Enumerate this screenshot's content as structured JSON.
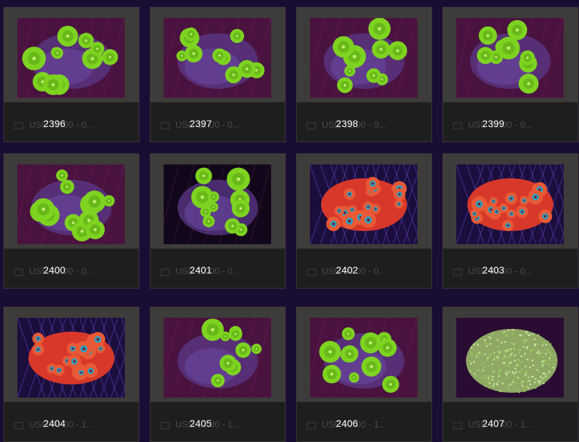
{
  "items": [
    {
      "id": "2396",
      "price": "USD 12.00 - 0...",
      "photo": "green-mushroom-coral",
      "bg": "pink"
    },
    {
      "id": "2397",
      "price": "USD 12.00 - 0...",
      "photo": "green-mushroom-coral",
      "bg": "pink"
    },
    {
      "id": "2398",
      "price": "USD 12.00 - 0...",
      "photo": "green-mushroom-coral",
      "bg": "pink"
    },
    {
      "id": "2399",
      "price": "USD 12.00 - 0...",
      "photo": "green-mushroom-coral",
      "bg": "pink"
    },
    {
      "id": "2400",
      "price": "USD 12.00 - 0...",
      "photo": "green-mushroom-coral",
      "bg": "pink"
    },
    {
      "id": "2401",
      "price": "USD 12.00 - 0...",
      "photo": "green-mushroom-coral",
      "bg": "dark"
    },
    {
      "id": "2402",
      "price": "USD 30.00 - 0...",
      "photo": "red-acan-coral",
      "bg": "blue"
    },
    {
      "id": "2403",
      "price": "USD 40.00 - 0...",
      "photo": "red-acan-coral",
      "bg": "blue"
    },
    {
      "id": "2404",
      "price": "USD 40.00 - 1...",
      "photo": "red-acan-coral",
      "bg": "blue"
    },
    {
      "id": "2405",
      "price": "USD 12.00 - 1...",
      "photo": "green-mushroom-coral",
      "bg": "pink"
    },
    {
      "id": "2406",
      "price": "USD 12.00 - 1...",
      "photo": "green-mushroom-coral",
      "bg": "pink"
    },
    {
      "id": "2407",
      "price": "USD 12.00 - 1...",
      "photo": "green-leather-coral",
      "bg": "pink"
    }
  ],
  "colors": {
    "page_bg": "#1a0d33",
    "frame": "#3d3c3a",
    "card": "#1e1e1e",
    "id_text": "#ffffff",
    "price_text": "#4a4a4a",
    "mushroom_green": "#7ed321",
    "acan_red": "#e0401f",
    "acan_center": "#2aa0c8"
  }
}
